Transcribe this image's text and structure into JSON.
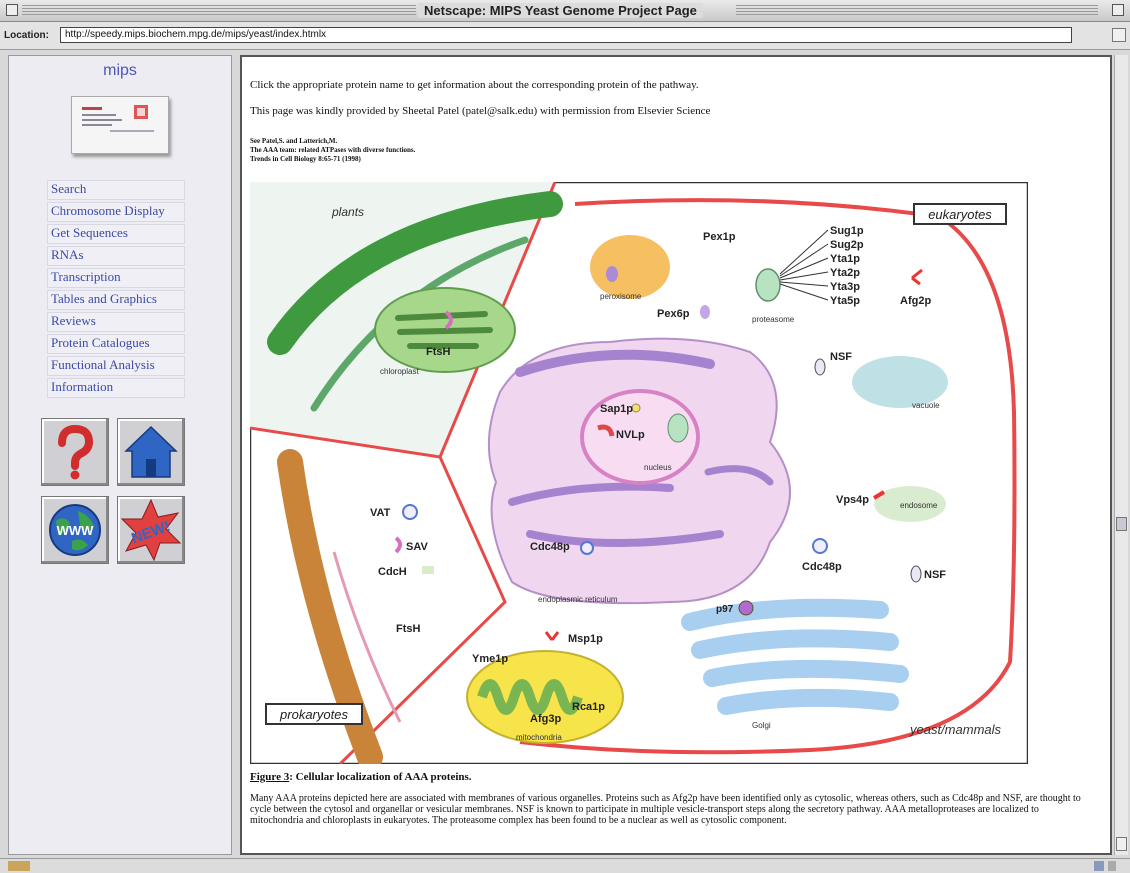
{
  "window": {
    "title": "Netscape: MIPS Yeast Genome Project Page"
  },
  "location": {
    "label": "Location:",
    "url": "http://speedy.mips.biochem.mpg.de/mips/yeast/index.htmlx"
  },
  "sidebar": {
    "logo_text": "mips",
    "nav": [
      "Search",
      "Chromosome Display",
      "Get Sequences",
      "RNAs",
      "Transcription",
      "Tables and Graphics",
      "Reviews",
      "Protein Catalogues",
      "Functional Analysis",
      "Information"
    ],
    "buttons": [
      {
        "name": "help",
        "icon": "question-mark-icon"
      },
      {
        "name": "home",
        "icon": "house-icon"
      },
      {
        "name": "www",
        "icon": "globe-icon",
        "text": "WWW"
      },
      {
        "name": "new",
        "icon": "new-badge-icon",
        "text": "NEW!"
      }
    ]
  },
  "content": {
    "intro1": "Click the appropriate protein name to get information about the corresponding protein of the pathway.",
    "intro2": "This page was kindly provided by Sheetal Patel (patel@salk.edu) with permission from Elsevier Science",
    "ref1": "See Patel,S. and Latterich,M.",
    "ref2": "The AAA team: related ATPases with diverse functions.",
    "ref3": "Trends in Cell Biology 8:65-71 (1998)",
    "figure": {
      "panels": {
        "plants": "plants",
        "eukaryotes": "eukaryotes",
        "prokaryotes": "prokaryotes",
        "yeast_mammals": "yeast/mammals"
      },
      "organelles": {
        "chloroplast": "chloroplast",
        "peroxisome": "peroxisome",
        "proteasome": "proteasome",
        "vacuole": "vacuole",
        "nucleus": "nucleus",
        "endosome": "endosome",
        "er": "endoplasmic reticulum",
        "golgi": "Golgi",
        "mitochondria": "mitochondria"
      },
      "proteins": {
        "ftsh_plant": "FtsH",
        "pex1p": "Pex1p",
        "pex6p": "Pex6p",
        "sug1p": "Sug1p",
        "sug2p": "Sug2p",
        "yta1p": "Yta1p",
        "yta2p": "Yta2p",
        "yta3p": "Yta3p",
        "yta5p": "Yta5p",
        "afg2p": "Afg2p",
        "nsf1": "NSF",
        "sap1p": "Sap1p",
        "nvlp": "NVLp",
        "vps4p": "Vps4p",
        "cdc48p_er": "Cdc48p",
        "cdc48p": "Cdc48p",
        "nsf2": "NSF",
        "p97": "p97",
        "vat": "VAT",
        "sav": "SAV",
        "cdch": "CdcH",
        "ftsh_pro": "FtsH",
        "yme1p": "Yme1p",
        "msp1p": "Msp1p",
        "afg3p": "Afg3p",
        "rca1p": "Rca1p"
      }
    },
    "caption_label": "Figure 3",
    "caption_title": ": Cellular localization of AAA proteins.",
    "caption_body": "Many AAA proteins depicted here are associated with membranes of various organelles. Proteins such as Afg2p have been identified only as cytosolic, whereas others, such as Cdc48p and NSF, are thought to cycle between the cytosol and organellar or vesicular membranes. NSF is known to participate in multiple vesicle-transport steps along the secretory pathway. AAA metalloproteases are localized to mitochondria and chloroplasts in eukaryotes. The proteasome complex has been found to be a nuclear as well as cytosolic component."
  }
}
